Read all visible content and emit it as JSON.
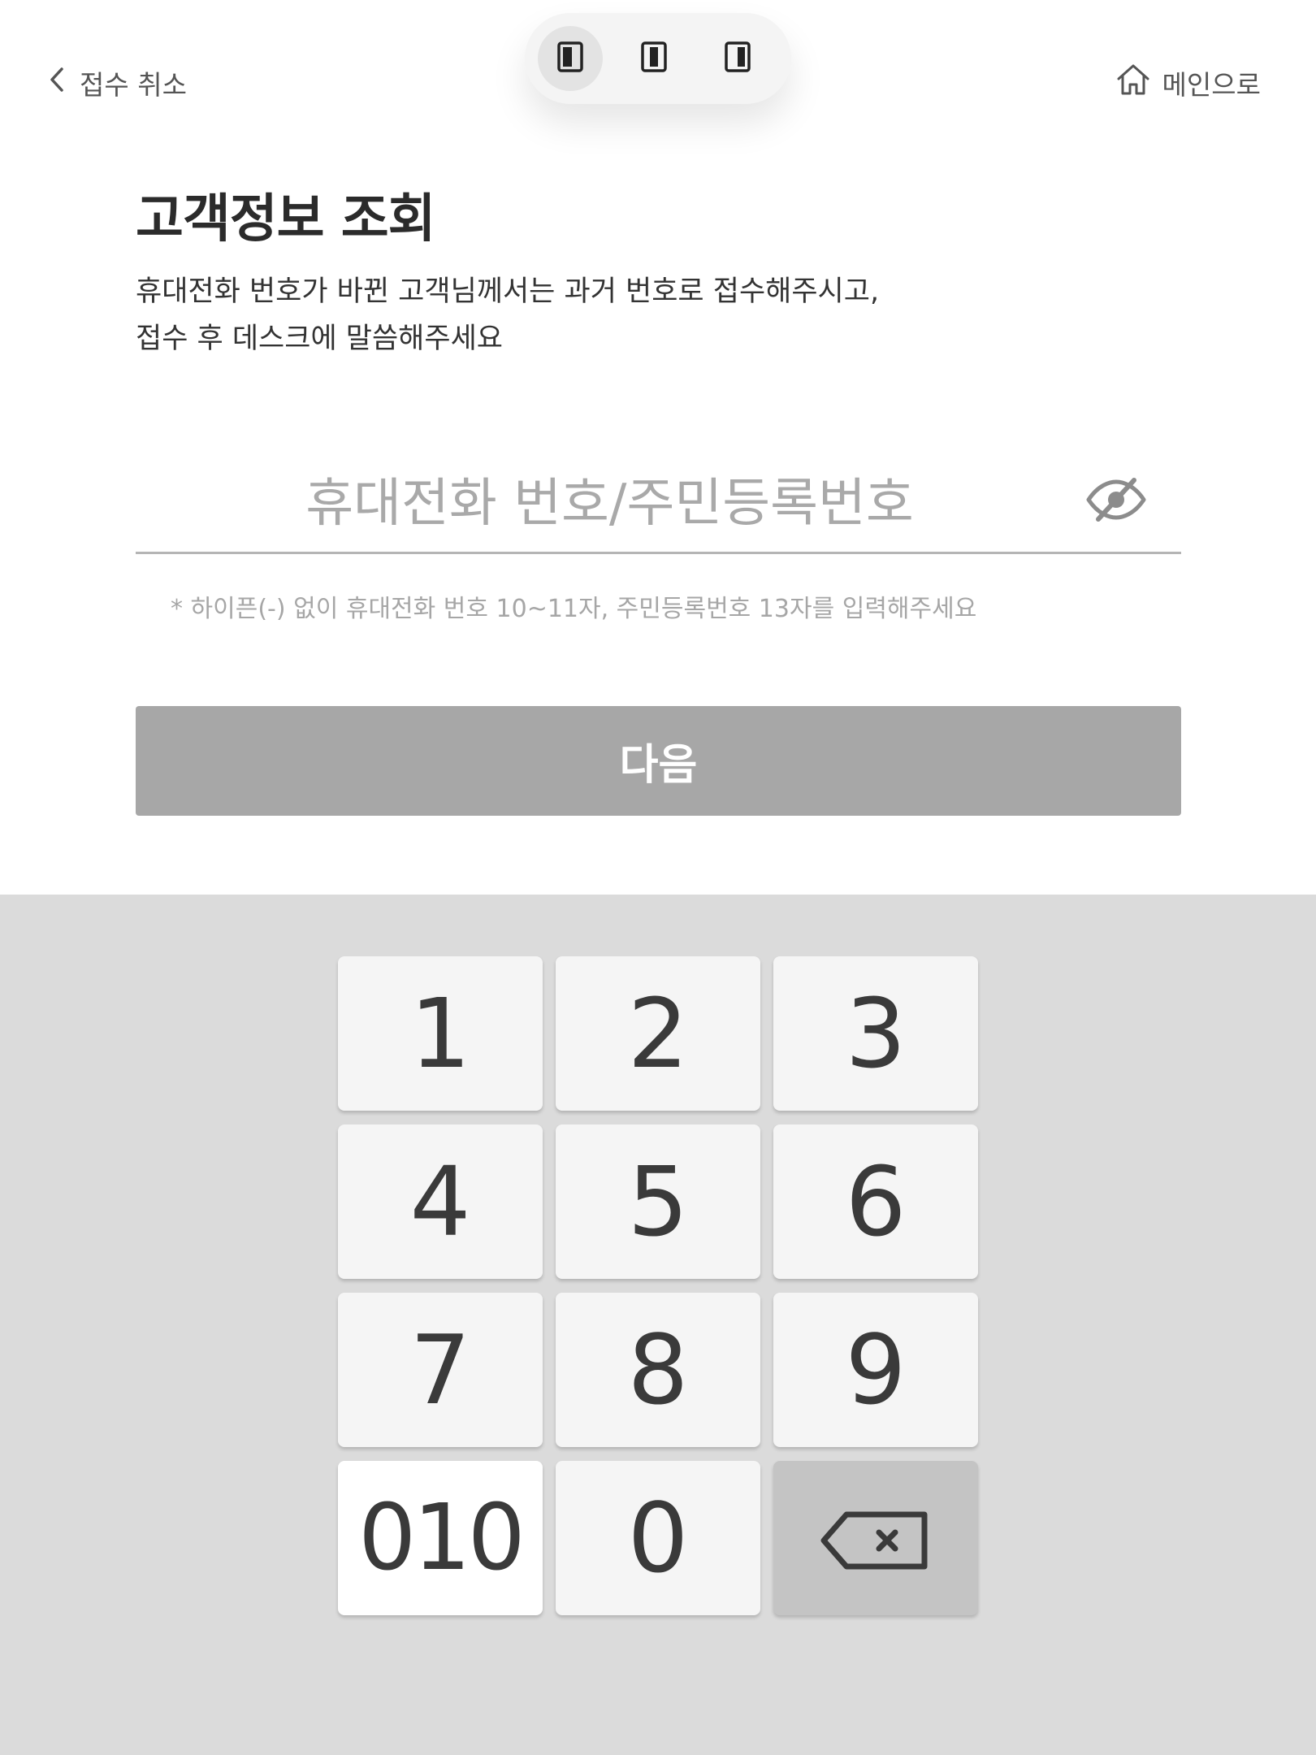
{
  "header": {
    "back_label": "접수 취소",
    "home_label": "메인으로"
  },
  "layout_switch": {
    "options": [
      "left-panel-icon",
      "center-panel-icon",
      "right-panel-icon"
    ],
    "active_index": 0
  },
  "main": {
    "title": "고객정보 조회",
    "description_line1": "휴대전화 번호가 바뀐 고객님께서는 과거 번호로 접수해주시고,",
    "description_line2": "접수 후 데스크에 말씀해주세요",
    "input_value": "",
    "input_placeholder": "휴대전화 번호/주민등록번호",
    "hint": "* 하이픈(-) 없이 휴대전화 번호 10~11자, 주민등록번호 13자를 입력해주세요",
    "next_label": "다음"
  },
  "keypad": {
    "keys": [
      "1",
      "2",
      "3",
      "4",
      "5",
      "6",
      "7",
      "8",
      "9",
      "010",
      "0"
    ],
    "backspace_icon": "backspace-icon"
  },
  "colors": {
    "next_button_disabled": "#a7a7a7",
    "keypad_background": "#dbdbdb",
    "key_background": "#f5f5f5",
    "backspace_key_background": "#c4c4c4"
  }
}
